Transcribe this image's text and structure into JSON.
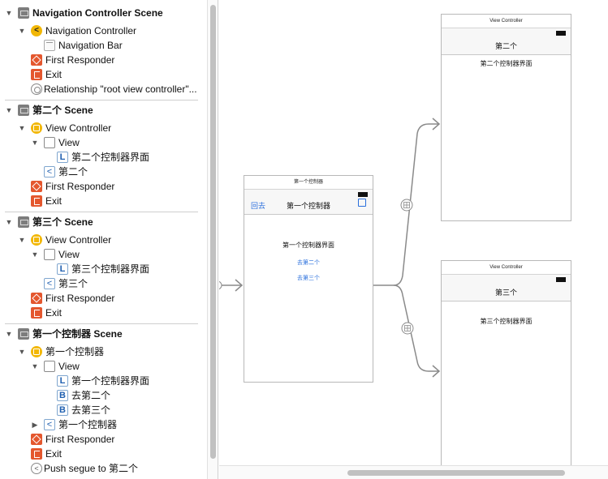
{
  "outline": {
    "scene_nav": {
      "title": "Navigation Controller Scene",
      "nav_controller": "Navigation Controller",
      "nav_bar": "Navigation Bar",
      "first_responder": "First Responder",
      "exit": "Exit",
      "relationship": "Relationship \"root view controller\"..."
    },
    "scene_second": {
      "title": "第二个 Scene",
      "view_controller": "View Controller",
      "view": "View",
      "label": "第二个控制器界面",
      "nav_item": "第二个",
      "first_responder": "First Responder",
      "exit": "Exit"
    },
    "scene_third": {
      "title": "第三个 Scene",
      "view_controller": "View Controller",
      "view": "View",
      "label": "第三个控制器界面",
      "nav_item": "第三个",
      "first_responder": "First Responder",
      "exit": "Exit"
    },
    "scene_first": {
      "title": "第一个控制器 Scene",
      "view_controller": "第一个控制器",
      "view": "View",
      "label": "第一个控制器界面",
      "button_second": "去第二个",
      "button_third": "去第三个",
      "nav_item": "第一个控制器",
      "first_responder": "First Responder",
      "exit": "Exit",
      "segue": "Push segue to 第二个"
    },
    "icon_glyphs": {
      "nav_controller": "<",
      "label": "L",
      "back": "<",
      "button": "B",
      "segue": "<"
    }
  },
  "canvas": {
    "first": {
      "title": "第一个控制器",
      "back_button": "回去",
      "nav_title": "第一个控制器",
      "body_label": "第一个控制器界面",
      "button_second": "去第二个",
      "button_third": "去第三个"
    },
    "second": {
      "title": "View Controller",
      "nav_title": "第二个",
      "body_label": "第二个控制器界面"
    },
    "third": {
      "title": "View Controller",
      "nav_title": "第三个",
      "body_label": "第三个控制器界面"
    }
  },
  "colors": {
    "accent_blue": "#2a6fdc",
    "icon_yellow": "#f2b705",
    "icon_red": "#e4572e",
    "segue_line": "#8a8a8a"
  }
}
